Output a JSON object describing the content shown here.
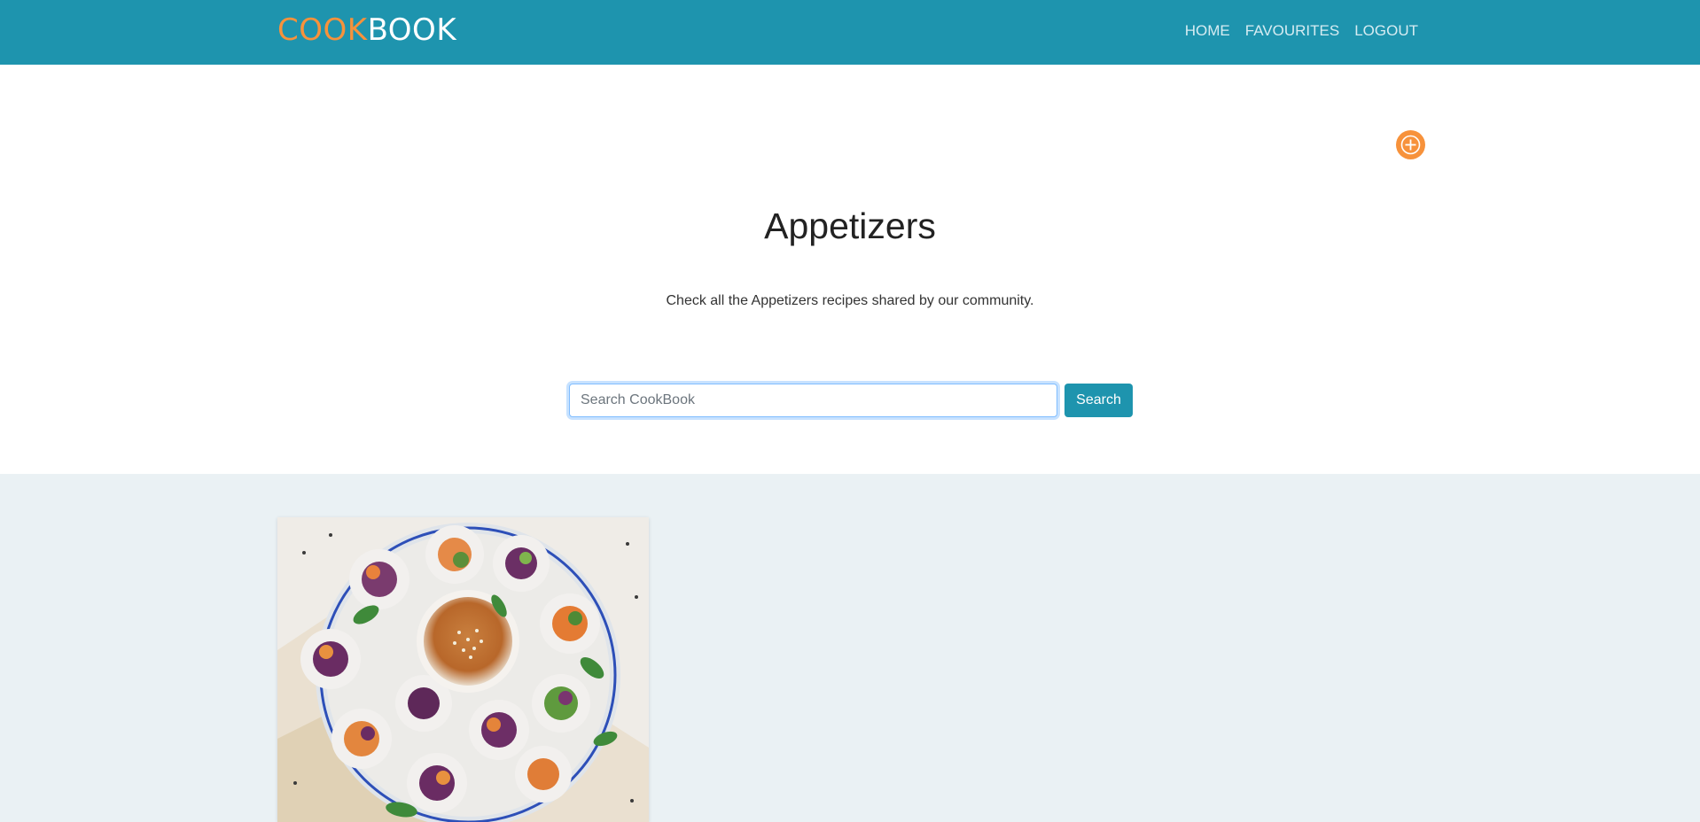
{
  "navbar": {
    "brand_part1": "COOK",
    "brand_part2": "BOOK",
    "links": [
      "HOME",
      "FAVOURITES",
      "LOGOUT"
    ]
  },
  "hero": {
    "add_icon": "plus-icon",
    "title": "Appetizers",
    "subtitle": "Check all the Appetizers recipes shared by our community.",
    "search": {
      "placeholder": "Search CookBook",
      "value": "",
      "button_label": "Search"
    }
  },
  "results": {
    "cards": [
      {
        "image": "spring-rolls-plate-image"
      }
    ]
  },
  "colors": {
    "navbar": "#1e94ae",
    "accent": "#f7923b",
    "results_bg": "#eaf1f4"
  }
}
